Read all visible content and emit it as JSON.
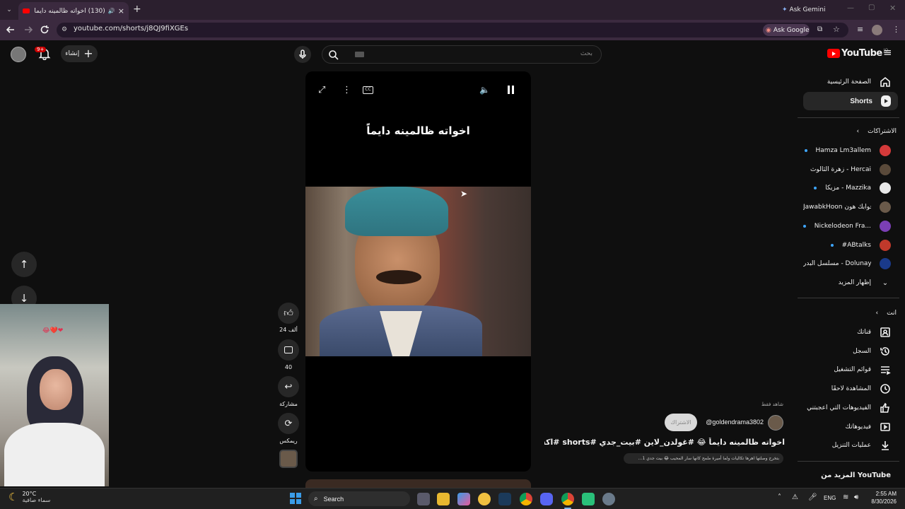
{
  "browser": {
    "tab_title": "(130) اخواته ظالمينه دايماً 😂",
    "tab_close": "×",
    "new_tab": "+",
    "ask_gemini": "Ask Gemini",
    "url": "youtube.com/shorts/j8QJ9fiXGEs",
    "ask_google": "Ask Google"
  },
  "youtube": {
    "logo_text": "YouTube",
    "logo_region": "JO",
    "search_placeholder": "بحث",
    "create_label": "إنشاء",
    "notif_count": "9+"
  },
  "sidebar": {
    "home": "الصفحة الرئيسية",
    "shorts": "Shorts",
    "subscriptions_header": "الاشتراكات",
    "subscriptions": [
      {
        "name": "Hamza Lm3allem",
        "color": "#d43a3a",
        "dot": true
      },
      {
        "name": "زهرة الثالوث - Hercai",
        "color": "#5a4a3a",
        "dot": false
      },
      {
        "name": "مزيكا - Mazzika",
        "color": "#e8e8e8",
        "dot": true
      },
      {
        "name": "JawabkHoon جوابك هون...",
        "color": "#6a5a4a",
        "dot": false
      },
      {
        "name": "Nickelodeon Fra...",
        "color": "#7b3fb5",
        "dot": true
      },
      {
        "name": "#ABtalks",
        "color": "#c0392b",
        "dot": true
      },
      {
        "name": "مسلسل البدر - Dolunay",
        "color": "#1a3a8a",
        "dot": false
      }
    ],
    "show_more": "إظهار المزيد",
    "you_header": "أنت",
    "you_items": [
      "قناتك",
      "السجل",
      "قوائم التشغيل",
      "المشاهدة لاحقًا",
      "الفيديوهات التي أعجبتني",
      "فيديوهاتك",
      "عمليات التنزيل"
    ],
    "more_from": "المزيد من YouTube"
  },
  "short": {
    "overlay_text": "اخواته ظالمينه دايماً",
    "likes": "24 ألف",
    "comments": "40",
    "share": "مشاركة",
    "remix": "ريمكس",
    "channel": "@goldendrama3802",
    "subscribe": "الاشتراك",
    "suggested": "شاهد فقط",
    "title": "اخواته ظالمينه دايماً 😂 #غولدن_لاين #بيت_جدي #shorts #اكسبلور",
    "desc": "بتخرج وصلتها اهرها تكاليات ولما أميرة ملمح كانها سار المحيب 😂 بيت جدي 1..."
  },
  "taskbar": {
    "weather_temp": "20°C",
    "weather_desc": "سماء صافية",
    "search": "Search",
    "lang": "ENG",
    "time": "2:55 AM",
    "date": "8/30/2026"
  }
}
